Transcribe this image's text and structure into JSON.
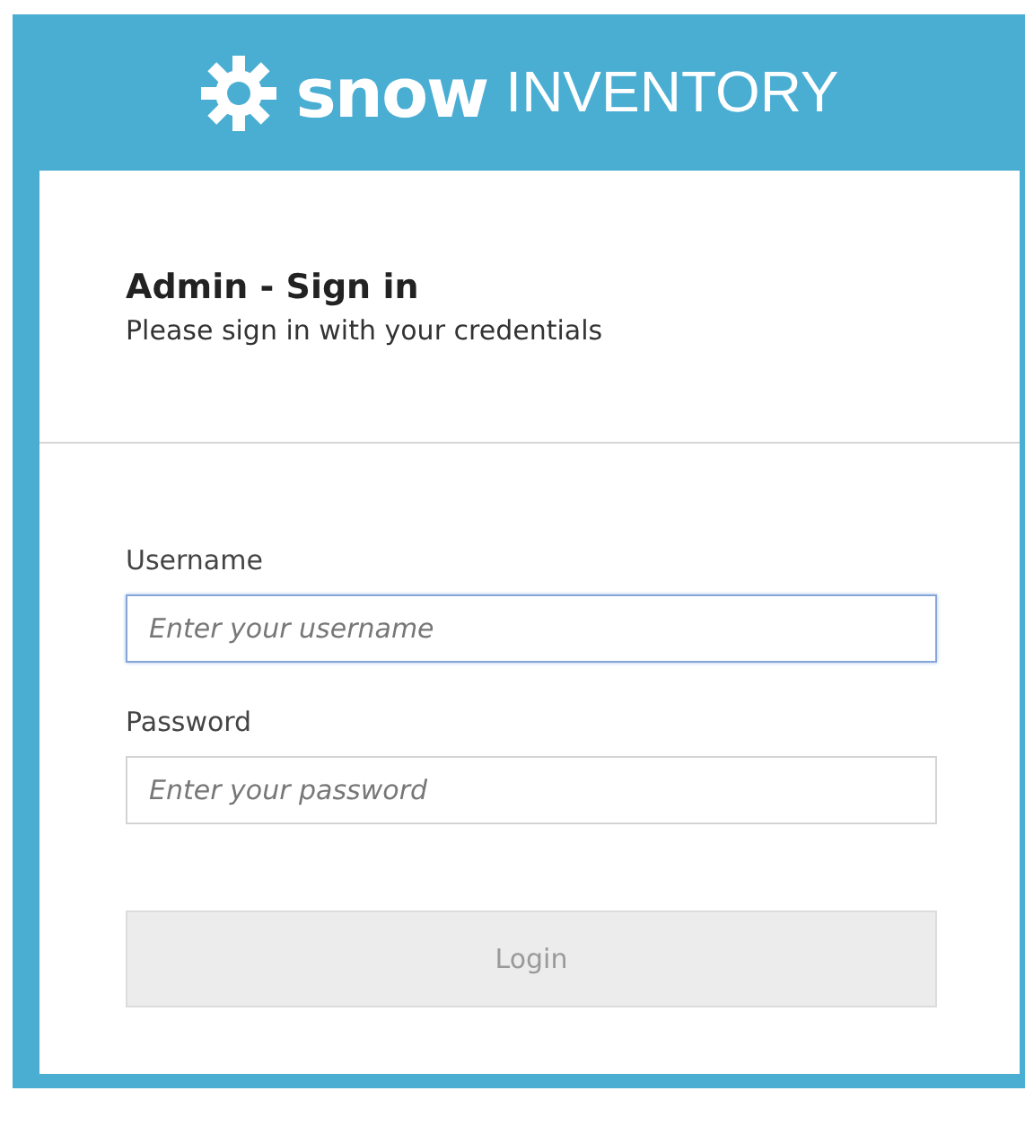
{
  "brand": {
    "name": "snow",
    "product": "INVENTORY"
  },
  "heading": {
    "title": "Admin - Sign in",
    "subtitle": "Please sign in with your credentials"
  },
  "fields": [
    {
      "label": "Username",
      "placeholder": "Enter your username",
      "focused": true
    },
    {
      "label": "Password",
      "placeholder": "Enter your password",
      "focused": false
    }
  ],
  "login_button": {
    "label": "Login",
    "disabled": true
  }
}
